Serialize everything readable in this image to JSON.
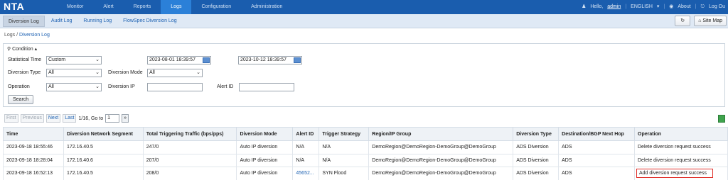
{
  "app": {
    "logo": "NTA"
  },
  "nav": {
    "items": [
      {
        "label": "Monitor",
        "active": false
      },
      {
        "label": "Alert",
        "active": false
      },
      {
        "label": "Reports",
        "active": false
      },
      {
        "label": "Logs",
        "active": true
      },
      {
        "label": "Configuration",
        "active": false
      },
      {
        "label": "Administration",
        "active": false
      }
    ]
  },
  "user": {
    "hello": "Hello,",
    "name": "admin",
    "lang": "ENGLISH",
    "about": "About",
    "logout": "Log Ou"
  },
  "subnav": {
    "items": [
      {
        "label": "Diversion Log",
        "active": true
      },
      {
        "label": "Audit Log",
        "active": false
      },
      {
        "label": "Running Log",
        "active": false
      },
      {
        "label": "FlowSpec Diversion Log",
        "active": false
      }
    ],
    "sitemap": "Site Map"
  },
  "breadcrumb": {
    "root": "Logs",
    "sep": "/",
    "current": "Diversion Log"
  },
  "condition": {
    "title": "Condition",
    "statistical_time_label": "Statistical Time",
    "statistical_time_value": "Custom",
    "start_time": "2023-08-01 18:39:57",
    "end_time": "2023-10-12 18:39:57",
    "diversion_type_label": "Diversion Type",
    "diversion_type_value": "All",
    "diversion_mode_label": "Diversion Mode",
    "diversion_mode_value": "All",
    "operation_label": "Operation",
    "operation_value": "All",
    "diversion_ip_label": "Diversion IP",
    "diversion_ip_value": "",
    "alert_id_label": "Alert ID",
    "alert_id_value": "",
    "search_label": "Search"
  },
  "pager": {
    "first": "First",
    "previous": "Previous",
    "next": "Next",
    "last": "Last",
    "info": "1/16, Go to",
    "page": "1",
    "go": "»"
  },
  "table": {
    "headers": [
      "Time",
      "Diversion Network Segment",
      "Total Triggering Traffic (bps/pps)",
      "Diversion Mode",
      "Alert ID",
      "Trigger Strategy",
      "Region/IP Group",
      "Diversion Type",
      "Destination/BGP Next Hop",
      "Operation"
    ],
    "rows": [
      [
        "2023-09-18 18:55:46",
        "172.16.40.5",
        "247/0",
        "Auto IP diversion",
        "N/A",
        "N/A",
        "DemoRegion@DemoRegion-DemoGroup@DemoGroup",
        "ADS Diversion",
        "ADS",
        "Delete diversion request success"
      ],
      [
        "2023-09-18 18:28:04",
        "172.16.40.6",
        "207/0",
        "Auto IP diversion",
        "N/A",
        "N/A",
        "DemoRegion@DemoRegion-DemoGroup@DemoGroup",
        "ADS Diversion",
        "ADS",
        "Delete diversion request success"
      ],
      [
        "2023-09-18 16:52:13",
        "172.16.40.5",
        "208/0",
        "Auto IP diversion",
        "45652...",
        "SYN Flood",
        "DemoRegion@DemoRegion-DemoGroup@DemoGroup",
        "ADS Diversion",
        "ADS",
        "Add diversion request success"
      ]
    ]
  },
  "colors": {
    "topbar": "#1a5dae",
    "active_nav": "#2b80d8",
    "link": "#1f63b3",
    "highlight": "#e0302a"
  }
}
